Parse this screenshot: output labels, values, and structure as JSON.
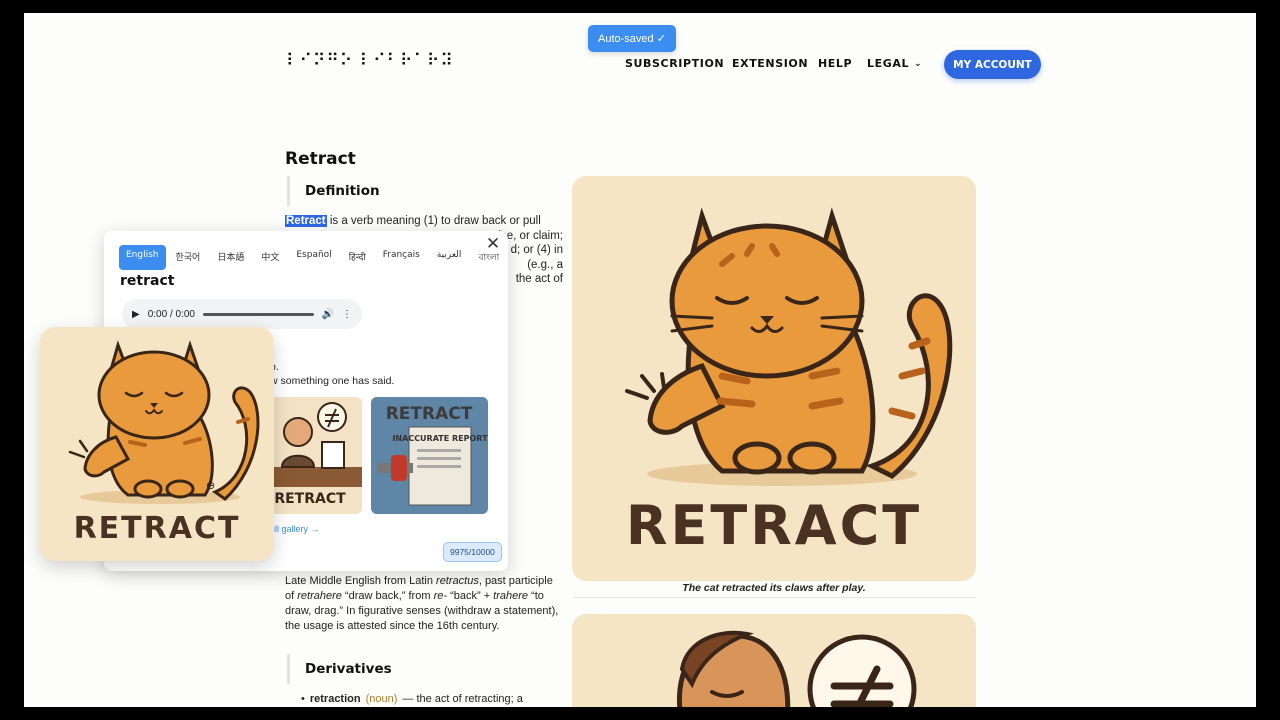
{
  "header": {
    "logo_text": "⠇⠊⠝⠛⠕ ⠇⠊⠃⠗⠁⠗⠽",
    "autosaved_label": "Auto-saved ✓",
    "nav": {
      "subscription": "SUBSCRIPTION",
      "extension": "EXTENSION",
      "help": "HELP",
      "legal": "LEGAL",
      "legal_chevron": "⌄"
    },
    "account_button": "MY ACCOUNT"
  },
  "entry": {
    "word": "Retract",
    "definition_heading": "Definition",
    "definition_highlight": "Retract",
    "definition_rest": " is a verb meaning (1) to draw back or pull",
    "definition_lines": [
      "ise, or claim;",
      "d; or (4) in",
      "(e.g., a",
      "the act of"
    ],
    "definition_link": "in",
    "etymology": {
      "p1": "Late Middle English from Latin ",
      "latin1": "retractus",
      "p2": ", past participle of ",
      "latin2": "retrahere",
      "p3": " “draw back,” from ",
      "prefix": "re-",
      "p4": " “back” + ",
      "latin3": "trahere",
      "p5": " “to draw, drag.” In figurative senses (withdraw a statement), the usage is attested since the 16th century."
    },
    "derivatives_heading": "Derivatives",
    "derivative": {
      "word": "retraction",
      "pos": "(noun)",
      "gloss": "— the act of retracting; a"
    }
  },
  "main_image": {
    "text": "RETRACT",
    "caption": "The cat retracted its claws after play."
  },
  "popup": {
    "close_icon": "✕",
    "languages": [
      "English",
      "한국어",
      "日本語",
      "中文",
      "Español",
      "हिन्दी",
      "Français",
      "العربية",
      "বাংলা"
    ],
    "active_language": "English",
    "word": "retract",
    "audio_time": "0:00 / 0:00",
    "line1": "p.",
    "line2": "w something one has said.",
    "thumb1_text": "RETRACT",
    "thumb2_title": "RETRACT",
    "thumb2_paper": "INACCURATE REPORT",
    "gallery_link": "ull gallery →",
    "counter": "9975/10000"
  },
  "sticker": {
    "text": "RETRACT"
  },
  "colors": {
    "accent": "#2f67e0",
    "autosave": "#3b8df0",
    "card_bg": "#f5e5c5",
    "cat_orange": "#e89a3c",
    "text_brown": "#4a3122"
  }
}
